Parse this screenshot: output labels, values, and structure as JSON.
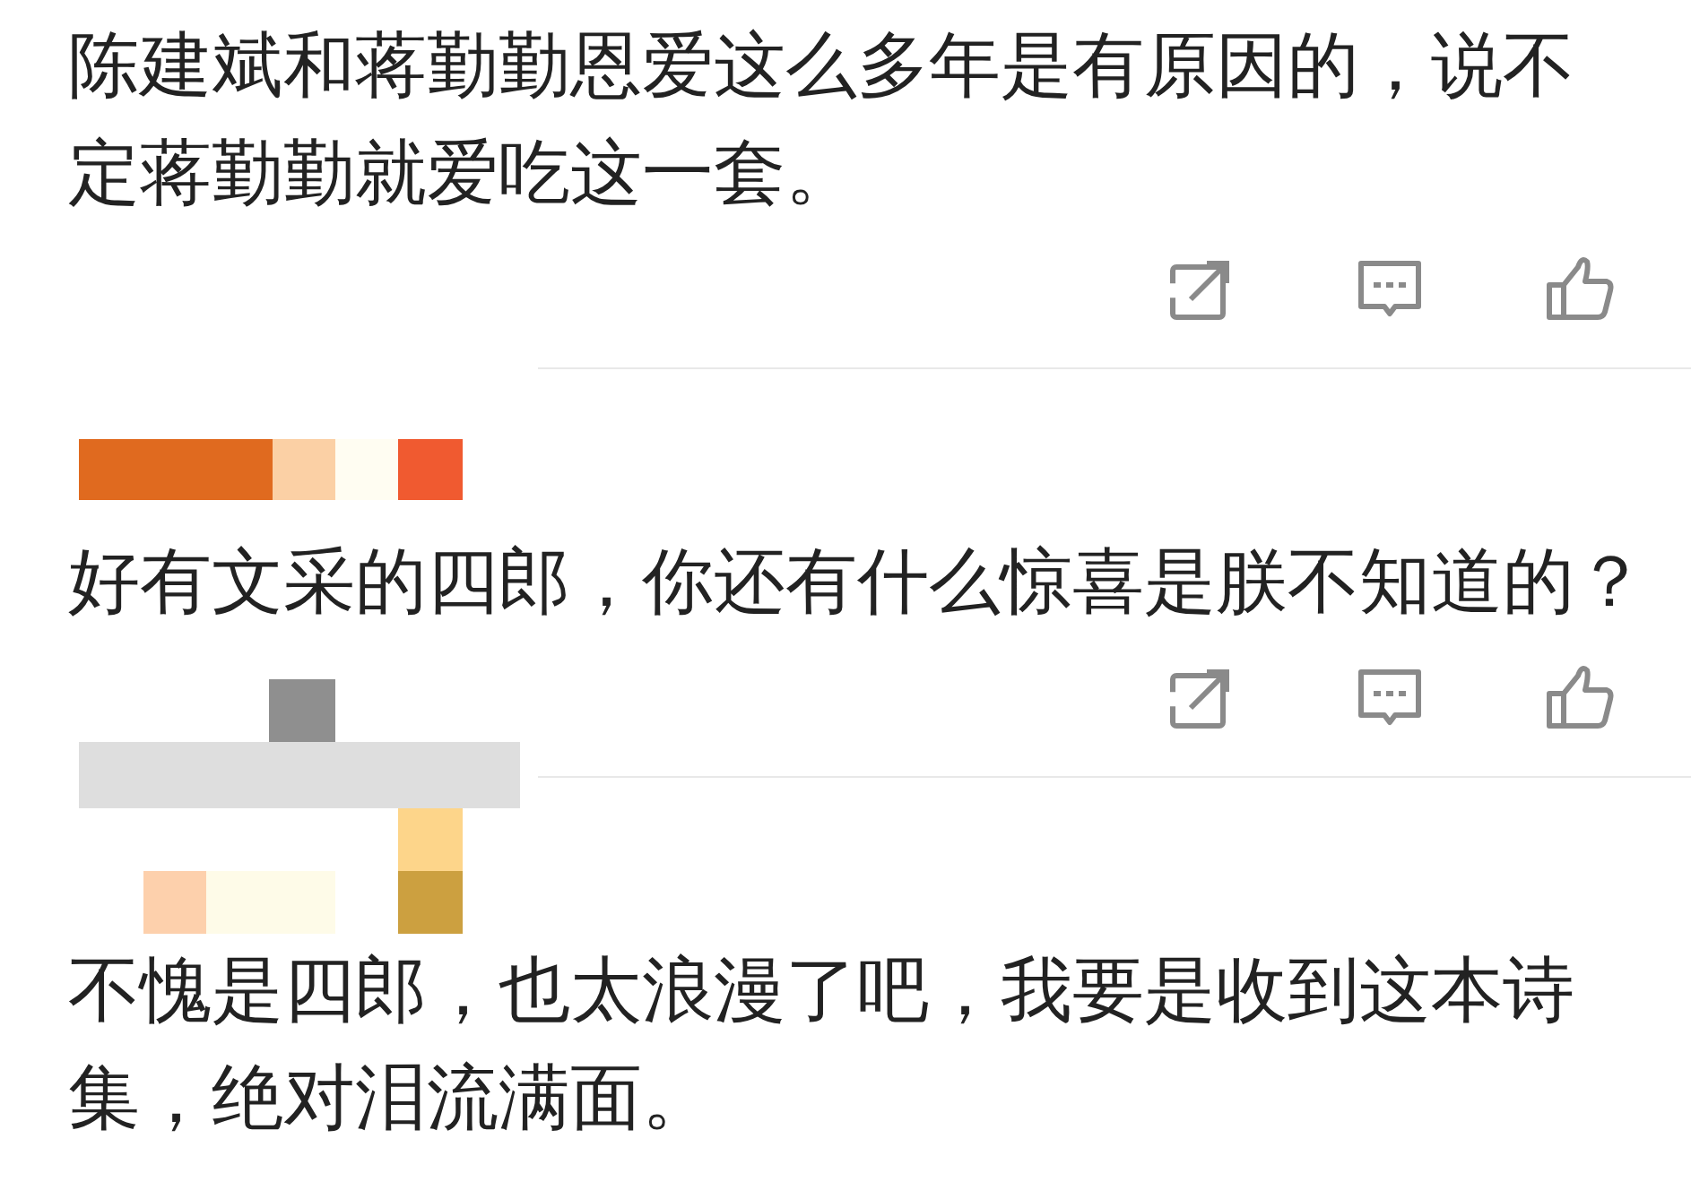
{
  "comments": [
    {
      "text_lines": [
        "陈建斌和蒋勤勤恩爱这么多年是有原因的，说不",
        "定蒋勤勤就爱吃这一套。"
      ],
      "actions": [
        {
          "kind": "share"
        },
        {
          "kind": "comment"
        },
        {
          "kind": "like"
        }
      ]
    },
    {
      "author": {
        "kind": "mosaic"
      },
      "text_lines": [
        "好有文采的四郎，你还有什么惊喜是朕不知道的？"
      ],
      "actions": [
        {
          "kind": "share"
        },
        {
          "kind": "comment"
        },
        {
          "kind": "like"
        }
      ]
    },
    {
      "author": {
        "kind": "mosaic"
      },
      "text_lines": [
        "不愧是四郎，也太浪漫了吧，我要是收到这本诗",
        "集，绝对泪流满面。"
      ]
    }
  ]
}
